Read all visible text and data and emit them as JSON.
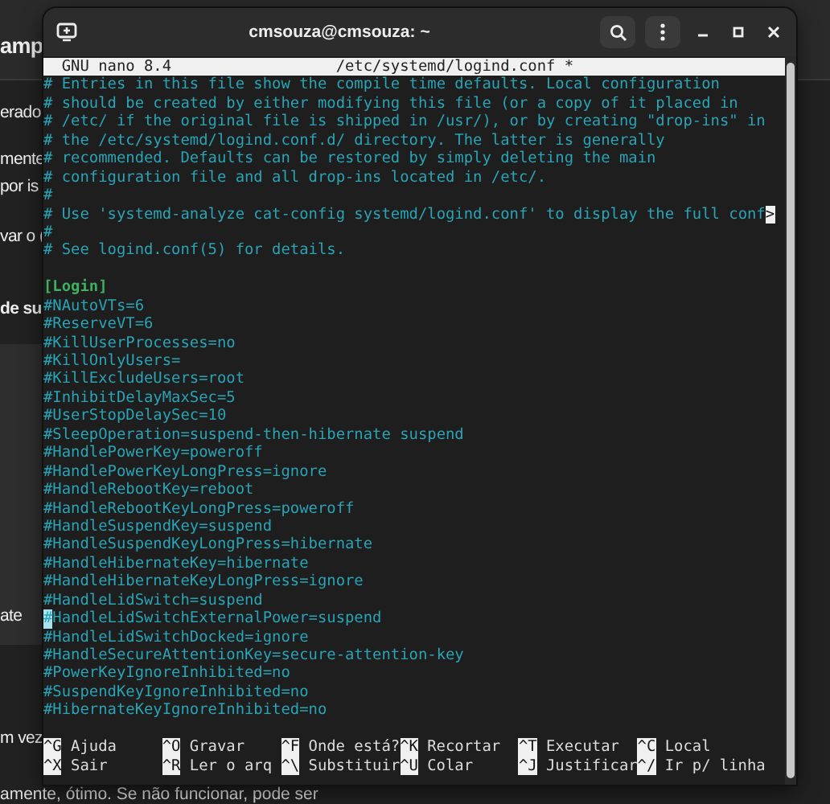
{
  "background_page": {
    "title": "amp",
    "fragments": [
      {
        "text": "erado"
      },
      {
        "text": "mente"
      },
      {
        "text": "por is"
      },
      {
        "text": "var o ("
      },
      {
        "text": "de su"
      },
      {
        "text": "ate"
      },
      {
        "text": "m vez"
      }
    ],
    "footer_text": "amente, ótimo. Se não funcionar, pode ser"
  },
  "terminal": {
    "title": "cmsouza@cmsouza: ~",
    "header": {
      "app": "GNU nano 8.4",
      "file": "/etc/systemd/logind.conf *"
    },
    "lines": [
      {
        "kind": "comment",
        "text": "# Entries in this file show the compile time defaults. Local configuration",
        "cursor": false
      },
      {
        "kind": "comment",
        "text": "# should be created by either modifying this file (or a copy of it placed in",
        "cursor": false
      },
      {
        "kind": "comment",
        "text": "# /etc/ if the original file is shipped in /usr/), or by creating \"drop-ins\" in",
        "cursor": false
      },
      {
        "kind": "comment",
        "text": "# the /etc/systemd/logind.conf.d/ directory. The latter is generally",
        "cursor": false
      },
      {
        "kind": "comment",
        "text": "# recommended. Defaults can be restored by simply deleting the main",
        "cursor": false
      },
      {
        "kind": "comment",
        "text": "# configuration file and all drop-ins located in /etc/.",
        "cursor": false
      },
      {
        "kind": "comment",
        "text": "#",
        "cursor": false
      },
      {
        "kind": "comment",
        "text": "# Use 'systemd-analyze cat-config systemd/logind.conf' to display the full conf",
        "overflow_mark": ">",
        "cursor": false
      },
      {
        "kind": "comment",
        "text": "#",
        "cursor": false
      },
      {
        "kind": "comment",
        "text": "# See logind.conf(5) for details.",
        "cursor": false
      },
      {
        "kind": "blank",
        "cursor": false
      },
      {
        "kind": "section",
        "text": "[Login]",
        "cursor": false
      },
      {
        "kind": "setting",
        "text": "#NAutoVTs=6",
        "cursor": false
      },
      {
        "kind": "setting",
        "text": "#ReserveVT=6",
        "cursor": false
      },
      {
        "kind": "setting",
        "text": "#KillUserProcesses=no",
        "cursor": false
      },
      {
        "kind": "setting",
        "text": "#KillOnlyUsers=",
        "cursor": false
      },
      {
        "kind": "setting",
        "text": "#KillExcludeUsers=root",
        "cursor": false
      },
      {
        "kind": "setting",
        "text": "#InhibitDelayMaxSec=5",
        "cursor": false
      },
      {
        "kind": "setting",
        "text": "#UserStopDelaySec=10",
        "cursor": false
      },
      {
        "kind": "setting",
        "text": "#SleepOperation=suspend-then-hibernate suspend",
        "cursor": false
      },
      {
        "kind": "setting",
        "text": "#HandlePowerKey=poweroff",
        "cursor": false
      },
      {
        "kind": "setting",
        "text": "#HandlePowerKeyLongPress=ignore",
        "cursor": false
      },
      {
        "kind": "setting",
        "text": "#HandleRebootKey=reboot",
        "cursor": false
      },
      {
        "kind": "setting",
        "text": "#HandleRebootKeyLongPress=poweroff",
        "cursor": false
      },
      {
        "kind": "setting",
        "text": "#HandleSuspendKey=suspend",
        "cursor": false
      },
      {
        "kind": "setting",
        "text": "#HandleSuspendKeyLongPress=hibernate",
        "cursor": false
      },
      {
        "kind": "setting",
        "text": "#HandleHibernateKey=hibernate",
        "cursor": false
      },
      {
        "kind": "setting",
        "text": "#HandleHibernateKeyLongPress=ignore",
        "cursor": false
      },
      {
        "kind": "setting",
        "text": "#HandleLidSwitch=suspend",
        "cursor": false
      },
      {
        "kind": "setting",
        "text": "#HandleLidSwitchExternalPower=suspend",
        "cursor": true
      },
      {
        "kind": "setting",
        "text": "#HandleLidSwitchDocked=ignore",
        "cursor": false
      },
      {
        "kind": "setting",
        "text": "#HandleSecureAttentionKey=secure-attention-key",
        "cursor": false
      },
      {
        "kind": "setting",
        "text": "#PowerKeyIgnoreInhibited=no",
        "cursor": false
      },
      {
        "kind": "setting",
        "text": "#SuspendKeyIgnoreInhibited=no",
        "cursor": false
      },
      {
        "kind": "setting",
        "text": "#HibernateKeyIgnoreInhibited=no",
        "cursor": false
      },
      {
        "kind": "blank",
        "cursor": false
      }
    ],
    "shortcuts": [
      {
        "key": "^G",
        "label": "Ajuda"
      },
      {
        "key": "^O",
        "label": "Gravar"
      },
      {
        "key": "^F",
        "label": "Onde está?"
      },
      {
        "key": "^K",
        "label": "Recortar"
      },
      {
        "key": "^T",
        "label": "Executar"
      },
      {
        "key": "^C",
        "label": "Local"
      },
      {
        "key": "^X",
        "label": "Sair"
      },
      {
        "key": "^R",
        "label": "Ler o arq"
      },
      {
        "key": "^\\",
        "label": "Substituir"
      },
      {
        "key": "^U",
        "label": "Colar"
      },
      {
        "key": "^J",
        "label": "Justificar"
      },
      {
        "key": "^/",
        "label": "Ir p/ linha"
      }
    ]
  }
}
